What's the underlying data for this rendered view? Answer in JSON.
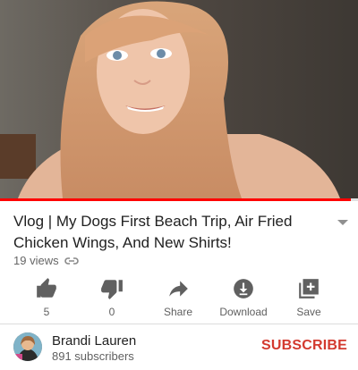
{
  "video": {
    "thumbnail_icon": "video-frame",
    "progress_fraction": 0.98
  },
  "title": "Vlog | My Dogs First Beach Trip, Air Fried Chicken Wings, And New Shirts!",
  "views": "19 views",
  "actions": [
    {
      "icon": "thumbs-up-icon",
      "label": "5"
    },
    {
      "icon": "thumbs-down-icon",
      "label": "0"
    },
    {
      "icon": "share-icon",
      "label": "Share"
    },
    {
      "icon": "download-icon",
      "label": "Download"
    },
    {
      "icon": "save-icon",
      "label": "Save"
    }
  ],
  "channel": {
    "name": "Brandi Lauren",
    "subscribers": "891 subscribers",
    "subscribe_label": "SUBSCRIBE"
  },
  "colors": {
    "accent": "#d33a2f",
    "progress": "#ff0000"
  }
}
